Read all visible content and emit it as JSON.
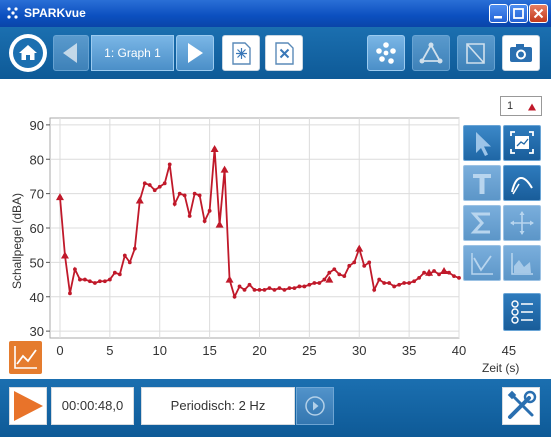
{
  "window": {
    "title": "SPARKvue"
  },
  "toolbar": {
    "graph_label": "1: Graph 1"
  },
  "graph": {
    "y_unit_label": "Schallpegel (dBA)",
    "x_unit_label": "Zeit (s)",
    "run_number": "1",
    "colors": {
      "line": "#c0192a",
      "grid": "#dcdcdc",
      "axis": "#555555"
    }
  },
  "chart_data": {
    "type": "line",
    "xlim": [
      -1,
      40
    ],
    "ylim": [
      28,
      92
    ],
    "x_ticks": [
      "0",
      "5",
      "10",
      "15",
      "20",
      "25",
      "30",
      "35",
      "40",
      "45"
    ],
    "y_ticks": [
      "30",
      "40",
      "50",
      "60",
      "70",
      "80",
      "90"
    ],
    "grid": true,
    "series": [
      {
        "x": [
          0,
          0.5,
          1,
          1.5,
          2,
          2.5,
          3,
          3.5,
          4,
          4.5,
          5,
          5.5,
          6,
          6.5,
          7,
          7.5,
          8,
          8.5,
          9,
          9.5,
          10,
          10.5,
          11,
          11.5,
          12,
          12.5,
          13,
          13.5,
          14,
          14.5,
          15,
          15.5,
          16,
          16.5,
          17,
          17.5,
          18,
          18.5,
          19,
          19.5,
          20,
          20.5,
          21,
          21.5,
          22,
          22.5,
          23,
          23.5,
          24,
          24.5,
          25,
          25.5,
          26,
          26.5,
          27,
          27.5,
          28,
          28.5,
          29,
          29.5,
          30,
          30.5,
          31,
          31.5,
          32,
          32.5,
          33,
          33.5,
          34,
          34.5,
          35,
          35.5,
          36,
          36.5,
          37,
          37.5,
          38,
          38.5,
          39,
          39.5,
          40
        ],
        "values": [
          69,
          52,
          41,
          48,
          45,
          45,
          44.5,
          44,
          44.5,
          44.5,
          45,
          47,
          46.5,
          52,
          50,
          54,
          68,
          73,
          72.5,
          71,
          72,
          73,
          78.5,
          67,
          70,
          69.5,
          63.5,
          70,
          69.5,
          62,
          65,
          83,
          61,
          77,
          45,
          40,
          43,
          42,
          43.5,
          42,
          42,
          42,
          42.5,
          42,
          42.5,
          42,
          42.5,
          42.5,
          43,
          43,
          43.5,
          44,
          44,
          45,
          47,
          48,
          46.5,
          46,
          49,
          50,
          54,
          49,
          50,
          42,
          45,
          44,
          44,
          43,
          43.5,
          44,
          44,
          44.5,
          45.5,
          47,
          46.5,
          47.5,
          46.5,
          47.5,
          47,
          46,
          45.5
        ]
      }
    ],
    "markers": [
      {
        "x": 0,
        "y": 69
      },
      {
        "x": 0.5,
        "y": 52
      },
      {
        "x": 8,
        "y": 68
      },
      {
        "x": 15.5,
        "y": 83
      },
      {
        "x": 16,
        "y": 61
      },
      {
        "x": 16.5,
        "y": 77
      },
      {
        "x": 17,
        "y": 45
      },
      {
        "x": 27,
        "y": 45
      },
      {
        "x": 30,
        "y": 54
      },
      {
        "x": 37,
        "y": 47
      },
      {
        "x": 38.5,
        "y": 47.5
      }
    ]
  },
  "controls": {
    "timer": "00:00:48,0",
    "mode": "Periodisch: 2 Hz"
  }
}
